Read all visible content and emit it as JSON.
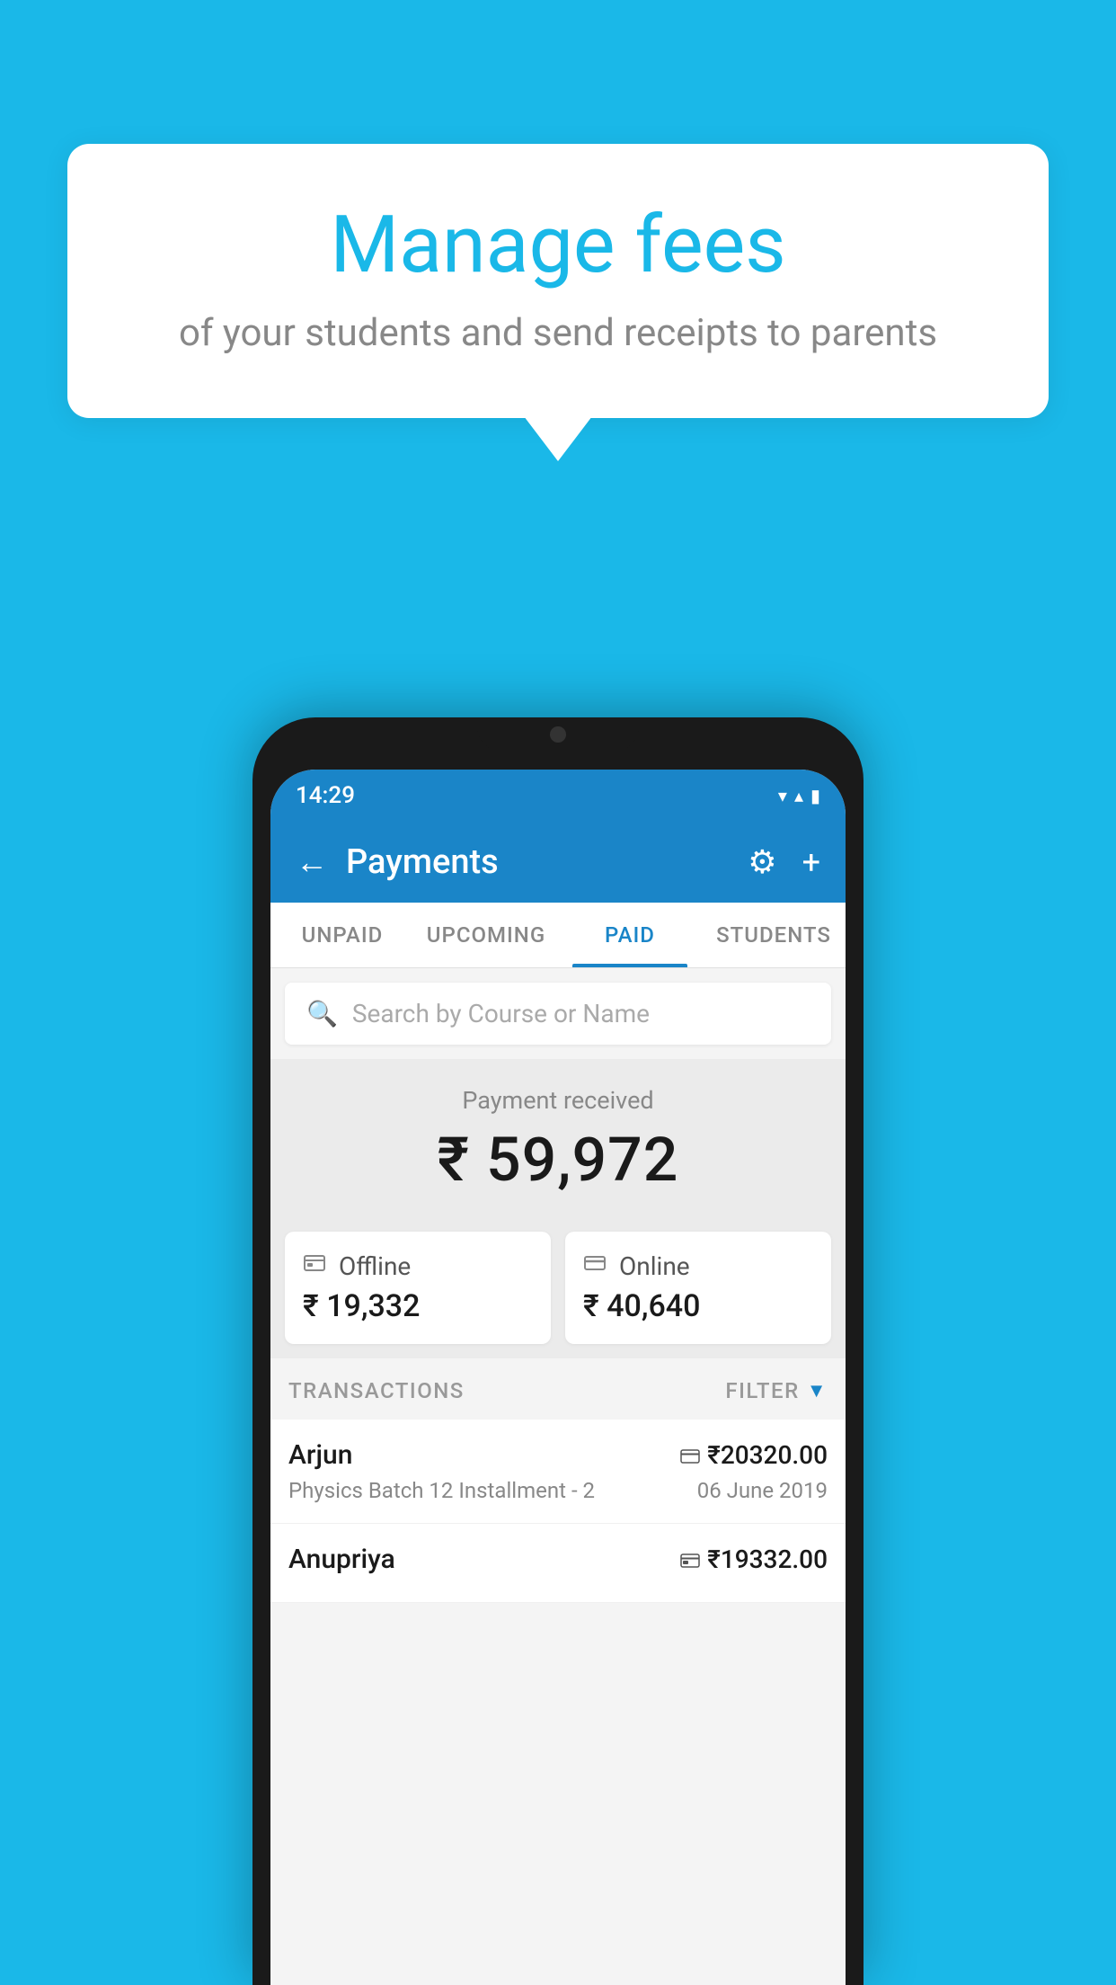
{
  "background_color": "#1ab8e8",
  "speech_bubble": {
    "title": "Manage fees",
    "subtitle": "of your students and send receipts to parents"
  },
  "status_bar": {
    "time": "14:29",
    "wifi_icon": "▼",
    "signal_icon": "▲",
    "battery_icon": "▮"
  },
  "header": {
    "title": "Payments",
    "back_label": "←",
    "gear_icon": "⚙",
    "plus_icon": "+"
  },
  "tabs": [
    {
      "label": "UNPAID",
      "active": false
    },
    {
      "label": "UPCOMING",
      "active": false
    },
    {
      "label": "PAID",
      "active": true
    },
    {
      "label": "STUDENTS",
      "active": false
    }
  ],
  "search": {
    "placeholder": "Search by Course or Name"
  },
  "payment_received": {
    "label": "Payment received",
    "amount": "₹ 59,972"
  },
  "payment_cards": [
    {
      "type": "Offline",
      "amount": "₹ 19,332",
      "icon": "💳"
    },
    {
      "type": "Online",
      "amount": "₹ 40,640",
      "icon": "💳"
    }
  ],
  "transactions_label": "TRANSACTIONS",
  "filter_label": "FILTER",
  "transactions": [
    {
      "name": "Arjun",
      "amount": "₹20320.00",
      "course": "Physics Batch 12 Installment - 2",
      "date": "06 June 2019",
      "payment_type": "online"
    },
    {
      "name": "Anupriya",
      "amount": "₹19332.00",
      "course": "",
      "date": "",
      "payment_type": "offline"
    }
  ]
}
